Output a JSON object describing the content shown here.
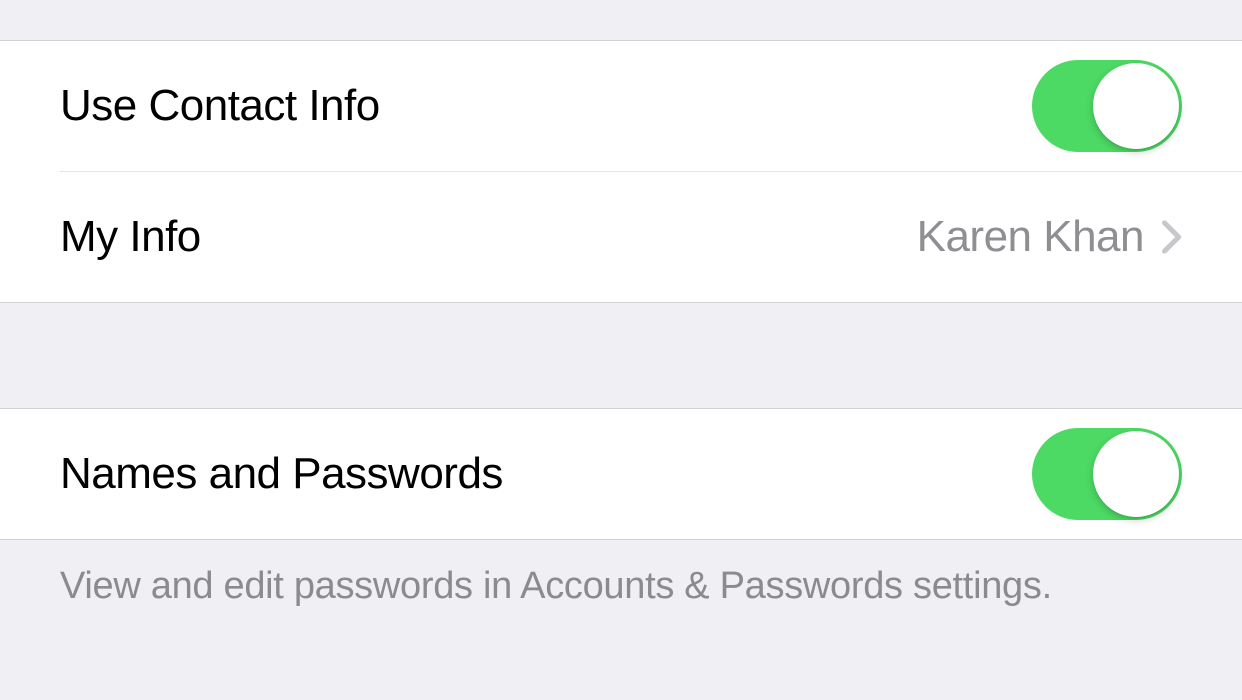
{
  "section1": {
    "useContactInfo": {
      "label": "Use Contact Info",
      "enabled": true
    },
    "myInfo": {
      "label": "My Info",
      "value": "Karen Khan"
    }
  },
  "section2": {
    "namesAndPasswords": {
      "label": "Names and Passwords",
      "enabled": true
    },
    "footer": "View and edit passwords in Accounts & Passwords settings."
  }
}
